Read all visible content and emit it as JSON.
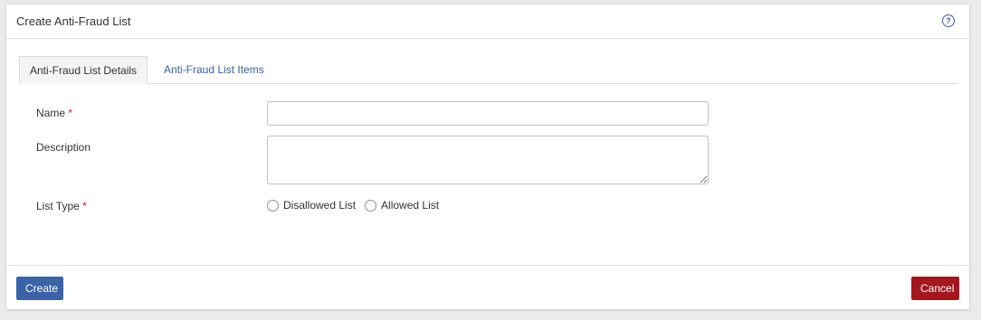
{
  "header": {
    "title": "Create Anti-Fraud List",
    "help_glyph": "?"
  },
  "tabs": [
    {
      "label": "Anti-Fraud List Details",
      "active": true
    },
    {
      "label": "Anti-Fraud List Items",
      "active": false
    }
  ],
  "form": {
    "name": {
      "label": "Name",
      "required_mark": "*",
      "value": ""
    },
    "description": {
      "label": "Description",
      "value": ""
    },
    "list_type": {
      "label": "List Type",
      "required_mark": "*",
      "options": [
        "Disallowed List",
        "Allowed List"
      ]
    }
  },
  "footer": {
    "create_label": "Create",
    "cancel_label": "Cancel"
  },
  "colors": {
    "primary": "#3c63a8",
    "danger": "#a3171e",
    "link": "#3c5f9e",
    "required": "#c0181f"
  },
  "icons": [
    "help-icon"
  ]
}
